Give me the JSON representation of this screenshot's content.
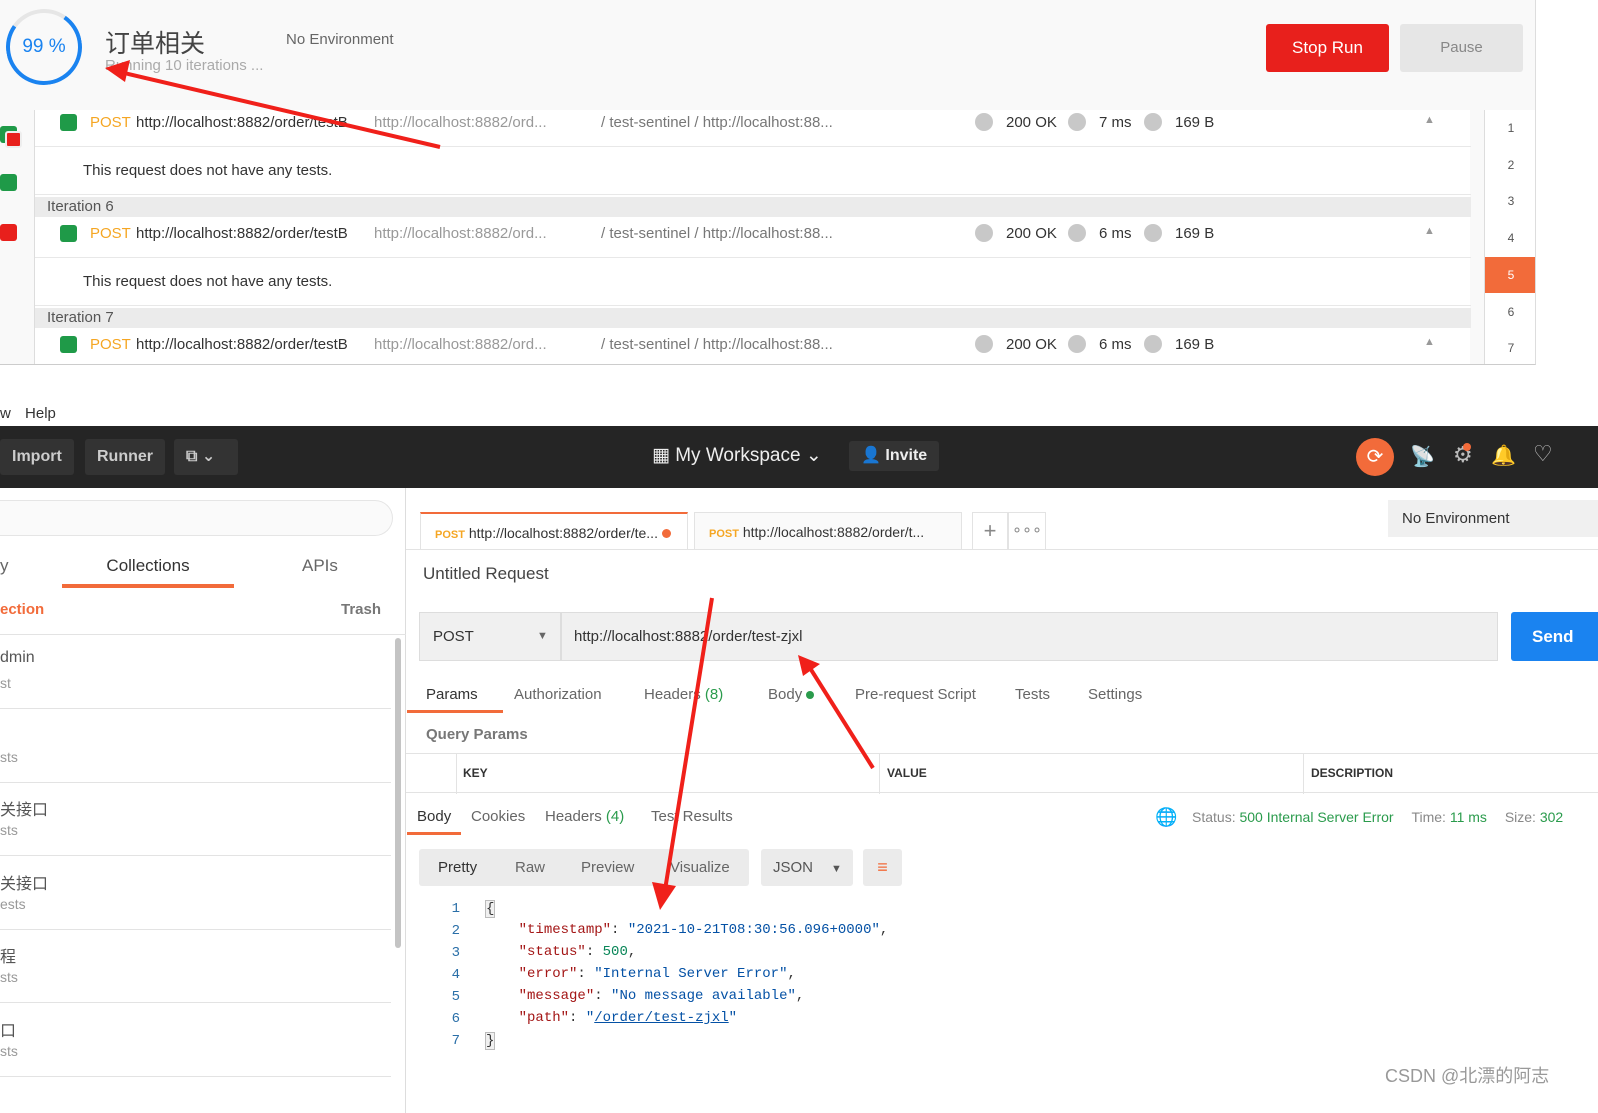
{
  "runner": {
    "progress_percent": 99,
    "progress_label": "99 %",
    "title": "订单相关",
    "environment": "No Environment",
    "subtitle": "Running 10 iterations ...",
    "stop_label": "Stop Run",
    "pause_label": "Pause",
    "rows": [
      {
        "type": "request",
        "method": "POST",
        "name": "http://localhost:8882/order/testB",
        "url": "http://localhost:8882/ord...",
        "path": "/ test-sentinel / http://localhost:88...",
        "status": "200 OK",
        "time": "7 ms",
        "size": "169 B"
      },
      {
        "type": "note",
        "text": "This request does not have any tests."
      },
      {
        "type": "iteration",
        "text": "Iteration 6"
      },
      {
        "type": "request",
        "method": "POST",
        "name": "http://localhost:8882/order/testB",
        "url": "http://localhost:8882/ord...",
        "path": "/ test-sentinel / http://localhost:88...",
        "status": "200 OK",
        "time": "6 ms",
        "size": "169 B"
      },
      {
        "type": "note",
        "text": "This request does not have any tests."
      },
      {
        "type": "iteration",
        "text": "Iteration 7"
      },
      {
        "type": "request",
        "method": "POST",
        "name": "http://localhost:8882/order/testB",
        "url": "http://localhost:8882/ord...",
        "path": "/ test-sentinel / http://localhost:88...",
        "status": "200 OK",
        "time": "6 ms",
        "size": "169 B"
      }
    ],
    "iterations": [
      "1",
      "2",
      "3",
      "4",
      "5",
      "6",
      "7"
    ],
    "active_iteration": "5"
  },
  "menu": {
    "items": [
      "w",
      "Help"
    ]
  },
  "toolbar": {
    "import": "Import",
    "runner": "Runner",
    "workspace": "My Workspace",
    "invite": "Invite",
    "accent": "#f26b3a"
  },
  "sidebar": {
    "tabs": [
      "y",
      "Collections",
      "APIs"
    ],
    "new_collection": "ection",
    "trash": "Trash",
    "collections": [
      {
        "name": "dmin",
        "sub": "st"
      },
      {
        "name": "",
        "sub": "sts"
      },
      {
        "name": "关接口",
        "sub": "sts"
      },
      {
        "name": "关接口",
        "sub": "ests"
      },
      {
        "name": "程",
        "sub": "sts"
      },
      {
        "name": "口",
        "sub": "sts"
      }
    ]
  },
  "request_tabs": [
    {
      "method": "POST",
      "label": "http://localhost:8882/order/te...",
      "unsaved": true
    },
    {
      "method": "POST",
      "label": "http://localhost:8882/order/t..."
    }
  ],
  "environment": "No Environment",
  "request": {
    "title": "Untitled Request",
    "method": "POST",
    "url": "http://localhost:8882/order/test-zjxl",
    "send": "Send",
    "tabs": [
      "Params",
      "Authorization",
      "Headers",
      "Body",
      "Pre-request Script",
      "Tests",
      "Settings"
    ],
    "headers_count": "(8)",
    "query_params": "Query Params",
    "columns": [
      "KEY",
      "VALUE",
      "DESCRIPTION"
    ]
  },
  "response": {
    "tabs": [
      "Body",
      "Cookies",
      "Headers",
      "Test Results"
    ],
    "headers_count": "(4)",
    "status_label": "Status:",
    "status": "500 Internal Server Error",
    "time_label": "Time:",
    "time": "11 ms",
    "size_label": "Size:",
    "size": "302",
    "views": [
      "Pretty",
      "Raw",
      "Preview",
      "Visualize"
    ],
    "format": "JSON",
    "lines": [
      "1",
      "2",
      "3",
      "4",
      "5",
      "6",
      "7"
    ],
    "json": {
      "timestamp_key": "\"timestamp\"",
      "timestamp": "\"2021-10-21T08:30:56.096+0000\"",
      "status_key": "\"status\"",
      "status": "500",
      "error_key": "\"error\"",
      "error": "\"Internal Server Error\"",
      "message_key": "\"message\"",
      "message": "\"No message available\"",
      "path_key": "\"path\"",
      "path": "/order/test-zjxl"
    }
  },
  "watermark": "CSDN @北漂的阿志"
}
